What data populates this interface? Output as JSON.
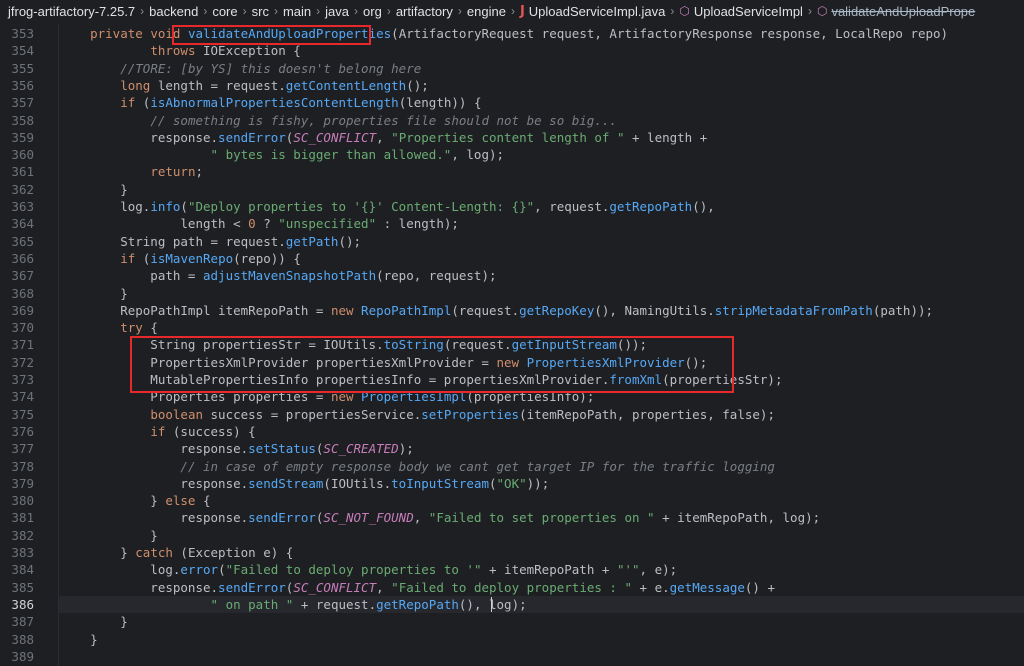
{
  "breadcrumb": {
    "items": [
      "jfrog-artifactory-7.25.7",
      "backend",
      "core",
      "src",
      "main",
      "java",
      "org",
      "artifactory",
      "engine"
    ],
    "file": "UploadServiceImpl.java",
    "class": "UploadServiceImpl",
    "method": "validateAndUploadPrope"
  },
  "icons": {
    "separator": "›",
    "java": "J",
    "class": "⬡",
    "method": "⬡"
  },
  "editor": {
    "current_line": 386,
    "lines": [
      {
        "n": 353,
        "text": "    private void validateAndUploadProperties(ArtifactoryRequest request, ArtifactoryResponse response, LocalRepo repo)"
      },
      {
        "n": 354,
        "text": "            throws IOException {"
      },
      {
        "n": 355,
        "text": "        //TORE: [by YS] this doesn't belong here"
      },
      {
        "n": 356,
        "text": "        long length = request.getContentLength();"
      },
      {
        "n": 357,
        "text": "        if (isAbnormalPropertiesContentLength(length)) {"
      },
      {
        "n": 358,
        "text": "            // something is fishy, properties file should not be so big..."
      },
      {
        "n": 359,
        "text": "            response.sendError(SC_CONFLICT, \"Properties content length of \" + length +"
      },
      {
        "n": 360,
        "text": "                    \" bytes is bigger than allowed.\", log);"
      },
      {
        "n": 361,
        "text": "            return;"
      },
      {
        "n": 362,
        "text": "        }"
      },
      {
        "n": 363,
        "text": "        log.info(\"Deploy properties to '{}' Content-Length: {}\", request.getRepoPath(),"
      },
      {
        "n": 364,
        "text": "                length < 0 ? \"unspecified\" : length);"
      },
      {
        "n": 365,
        "text": "        String path = request.getPath();"
      },
      {
        "n": 366,
        "text": "        if (isMavenRepo(repo)) {"
      },
      {
        "n": 367,
        "text": "            path = adjustMavenSnapshotPath(repo, request);"
      },
      {
        "n": 368,
        "text": "        }"
      },
      {
        "n": 369,
        "text": "        RepoPathImpl itemRepoPath = new RepoPathImpl(request.getRepoKey(), NamingUtils.stripMetadataFromPath(path));"
      },
      {
        "n": 370,
        "text": "        try {"
      },
      {
        "n": 371,
        "text": "            String propertiesStr = IOUtils.toString(request.getInputStream());"
      },
      {
        "n": 372,
        "text": "            PropertiesXmlProvider propertiesXmlProvider = new PropertiesXmlProvider();"
      },
      {
        "n": 373,
        "text": "            MutablePropertiesInfo propertiesInfo = propertiesXmlProvider.fromXml(propertiesStr);"
      },
      {
        "n": 374,
        "text": "            Properties properties = new PropertiesImpl(propertiesInfo);"
      },
      {
        "n": 375,
        "text": "            boolean success = propertiesService.setProperties(itemRepoPath, properties, false);"
      },
      {
        "n": 376,
        "text": "            if (success) {"
      },
      {
        "n": 377,
        "text": "                response.setStatus(SC_CREATED);"
      },
      {
        "n": 378,
        "text": "                // in case of empty response body we cant get target IP for the traffic logging"
      },
      {
        "n": 379,
        "text": "                response.sendStream(IOUtils.toInputStream(\"OK\"));"
      },
      {
        "n": 380,
        "text": "            } else {"
      },
      {
        "n": 381,
        "text": "                response.sendError(SC_NOT_FOUND, \"Failed to set properties on \" + itemRepoPath, log);"
      },
      {
        "n": 382,
        "text": "            }"
      },
      {
        "n": 383,
        "text": "        } catch (Exception e) {"
      },
      {
        "n": 384,
        "text": "            log.error(\"Failed to deploy properties to '\" + itemRepoPath + \"'\", e);"
      },
      {
        "n": 385,
        "text": "            response.sendError(SC_CONFLICT, \"Failed to deploy properties : \" + e.getMessage() +"
      },
      {
        "n": 386,
        "text": "                    \" on path \" + request.getRepoPath(), log);"
      },
      {
        "n": 387,
        "text": "        }"
      },
      {
        "n": 388,
        "text": "    }"
      },
      {
        "n": 389,
        "text": ""
      }
    ]
  },
  "colors": {
    "background": "#1e1f22",
    "highlight_box": "#e8292c",
    "keyword": "#cf8e6d",
    "string": "#6aab73",
    "method": "#56a8f5",
    "comment": "#7a7e85",
    "constant": "#c77dbb"
  }
}
